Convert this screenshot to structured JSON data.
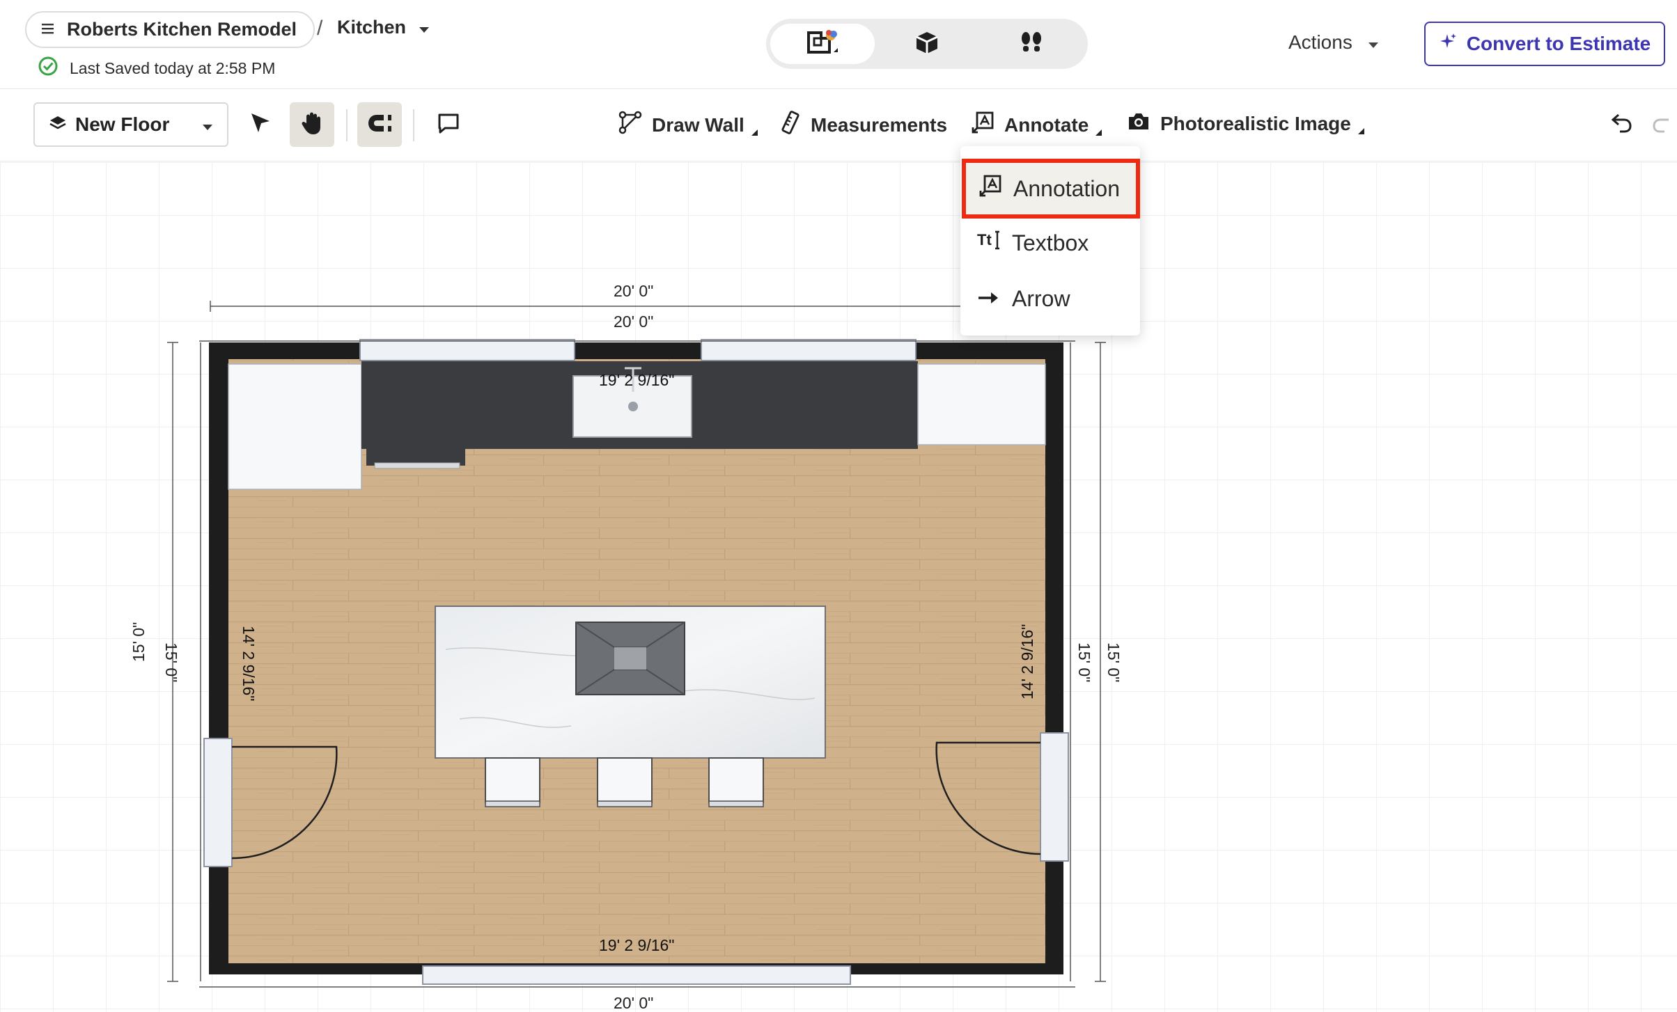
{
  "header": {
    "project_name": "Roberts Kitchen Remodel",
    "separator": "/",
    "room_name": "Kitchen",
    "save_status": "Last Saved today at 2:58 PM",
    "view_modes": [
      {
        "name": "2d-floorplan-icon",
        "active": true
      },
      {
        "name": "3d-box-icon",
        "active": false
      },
      {
        "name": "walkthrough-footprints-icon",
        "active": false
      }
    ],
    "actions_label": "Actions",
    "convert_label": "Convert to Estimate",
    "accent_color": "#3d36b0"
  },
  "toolbar": {
    "floor_label": "New Floor",
    "draw_wall": "Draw Wall",
    "measurements": "Measurements",
    "annotate": "Annotate",
    "photoreal": "Photorealistic Image"
  },
  "annotate_menu": {
    "items": [
      {
        "label": "Annotation",
        "icon": "annotation-icon",
        "highlighted": true
      },
      {
        "label": "Textbox",
        "icon": "textbox-icon",
        "highlighted": false
      },
      {
        "label": "Arrow",
        "icon": "arrow-icon",
        "highlighted": false
      }
    ],
    "highlight_color": "#ee2a12"
  },
  "floorplan": {
    "dim_top_outer": "20' 0\"",
    "dim_top_inner": "20' 0\"",
    "dim_top_interior": "19' 2 9/16\"",
    "dim_bottom_interior": "19' 2 9/16\"",
    "dim_bottom_outer": "20' 0\"",
    "dim_left_outer": "15' 0\"",
    "dim_left_inner": "15' 0\"",
    "dim_left_interior": "14' 2 9/16\"",
    "dim_right_interior": "14' 2 9/16\"",
    "dim_right_inner": "15' 0\"",
    "dim_right_outer": "15' 0\""
  }
}
